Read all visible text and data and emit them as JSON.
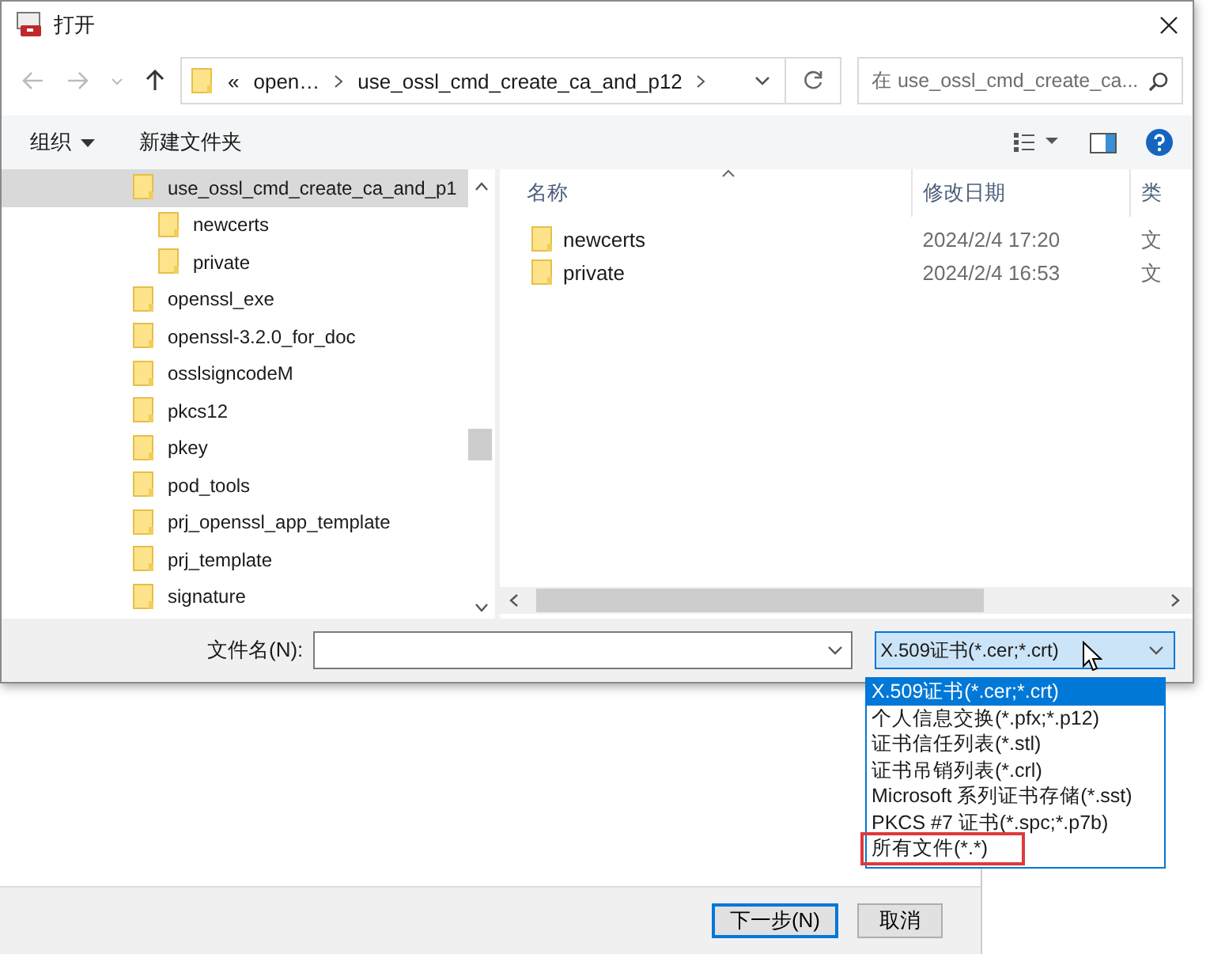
{
  "window": {
    "title": "打开"
  },
  "address": {
    "overflow": "«",
    "segments": [
      "open…",
      "use_ossl_cmd_create_ca_and_p12"
    ]
  },
  "search": {
    "placeholder": "在 use_ossl_cmd_create_ca..."
  },
  "toolbar": {
    "organize": "组织",
    "new_folder": "新建文件夹"
  },
  "tree": [
    {
      "label": "use_ossl_cmd_create_ca_and_p1",
      "selected": true,
      "children": [
        {
          "label": "newcerts",
          "selected": false
        },
        {
          "label": "private",
          "selected": false
        }
      ]
    },
    {
      "label": "openssl_exe",
      "selected": false
    },
    {
      "label": "openssl-3.2.0_for_doc",
      "selected": false
    },
    {
      "label": "osslsigncodeM",
      "selected": false
    },
    {
      "label": "pkcs12",
      "selected": false
    },
    {
      "label": "pkey",
      "selected": false
    },
    {
      "label": "pod_tools",
      "selected": false
    },
    {
      "label": "prj_openssl_app_template",
      "selected": false
    },
    {
      "label": "prj_template",
      "selected": false
    },
    {
      "label": "signature",
      "selected": false
    }
  ],
  "table": {
    "columns": [
      "名称",
      "修改日期",
      "类"
    ],
    "rows": [
      {
        "name": "newcerts",
        "date": "2024/2/4 17:20",
        "type": "文"
      },
      {
        "name": "private",
        "date": "2024/2/4 16:53",
        "type": "文"
      }
    ]
  },
  "filename": {
    "label": "文件名(N):"
  },
  "filter": {
    "value": "X.509证书(*.cer;*.crt)",
    "options": [
      {
        "label": "X.509证书(*.cer;*.crt)",
        "selected": true,
        "outlined": false
      },
      {
        "label": "个人信息交换(*.pfx;*.p12)",
        "selected": false,
        "outlined": false
      },
      {
        "label": "证书信任列表(*.stl)",
        "selected": false,
        "outlined": false
      },
      {
        "label": "证书吊销列表(*.crl)",
        "selected": false,
        "outlined": false
      },
      {
        "label": "Microsoft 系列证书存储(*.sst)",
        "selected": false,
        "outlined": false
      },
      {
        "label": "PKCS #7 证书(*.spc;*.p7b)",
        "selected": false,
        "outlined": false
      },
      {
        "label": "所有文件(*.*)",
        "selected": false,
        "outlined": true
      }
    ]
  },
  "background_window": {
    "buttons": [
      {
        "label": "下一步(N)",
        "default": true
      },
      {
        "label": "取消",
        "default": false
      }
    ]
  }
}
